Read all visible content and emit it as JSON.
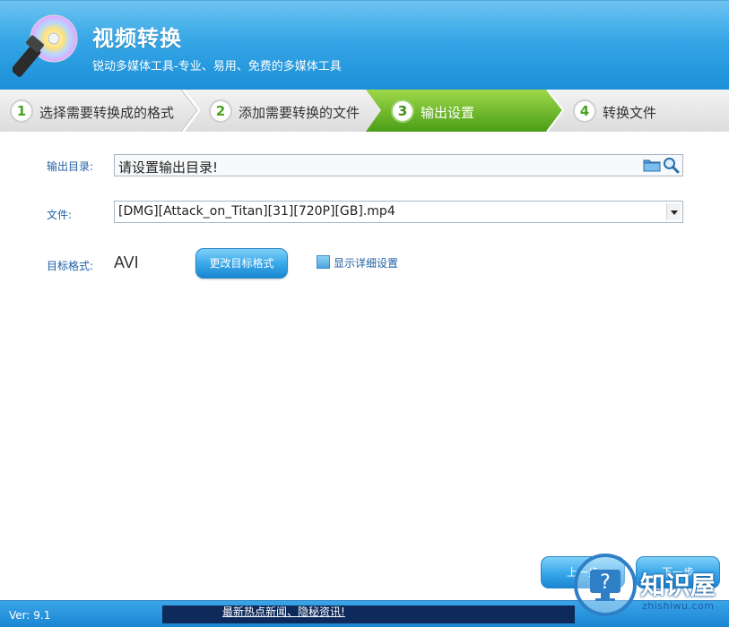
{
  "header": {
    "title": "视频转换",
    "subtitle": "锐动多媒体工具-专业、易用、免费的多媒体工具"
  },
  "steps": [
    {
      "number": "1",
      "label": "选择需要转换成的格式"
    },
    {
      "number": "2",
      "label": "添加需要转换的文件"
    },
    {
      "number": "3",
      "label": "输出设置"
    },
    {
      "number": "4",
      "label": "转换文件"
    }
  ],
  "active_step": 3,
  "form": {
    "output_dir_label": "输出目录:",
    "output_dir_value": "请设置输出目录!",
    "file_label": "文件:",
    "file_value": "[DMG][Attack_on_Titan][31][720P][GB].mp4",
    "target_format_label": "目标格式:",
    "target_format_value": "AVI",
    "change_format_button": "更改目标格式",
    "show_details_label": "显示详细设置"
  },
  "nav": {
    "prev_label": "上一步",
    "next_label": "下一步"
  },
  "status": {
    "version": "Ver: 9.1",
    "news": "最新热点新闻、隐秘资讯!"
  },
  "watermark": {
    "text": "知识屋",
    "url": "zhishiwu.com"
  },
  "colors": {
    "header_blue": "#35a6e6",
    "active_step_green": "#4aa421",
    "label_blue": "#1f5fa6"
  },
  "icons": [
    "app-logo-icon",
    "folder-icon",
    "search-icon",
    "dropdown-arrow-icon",
    "help-icon"
  ]
}
